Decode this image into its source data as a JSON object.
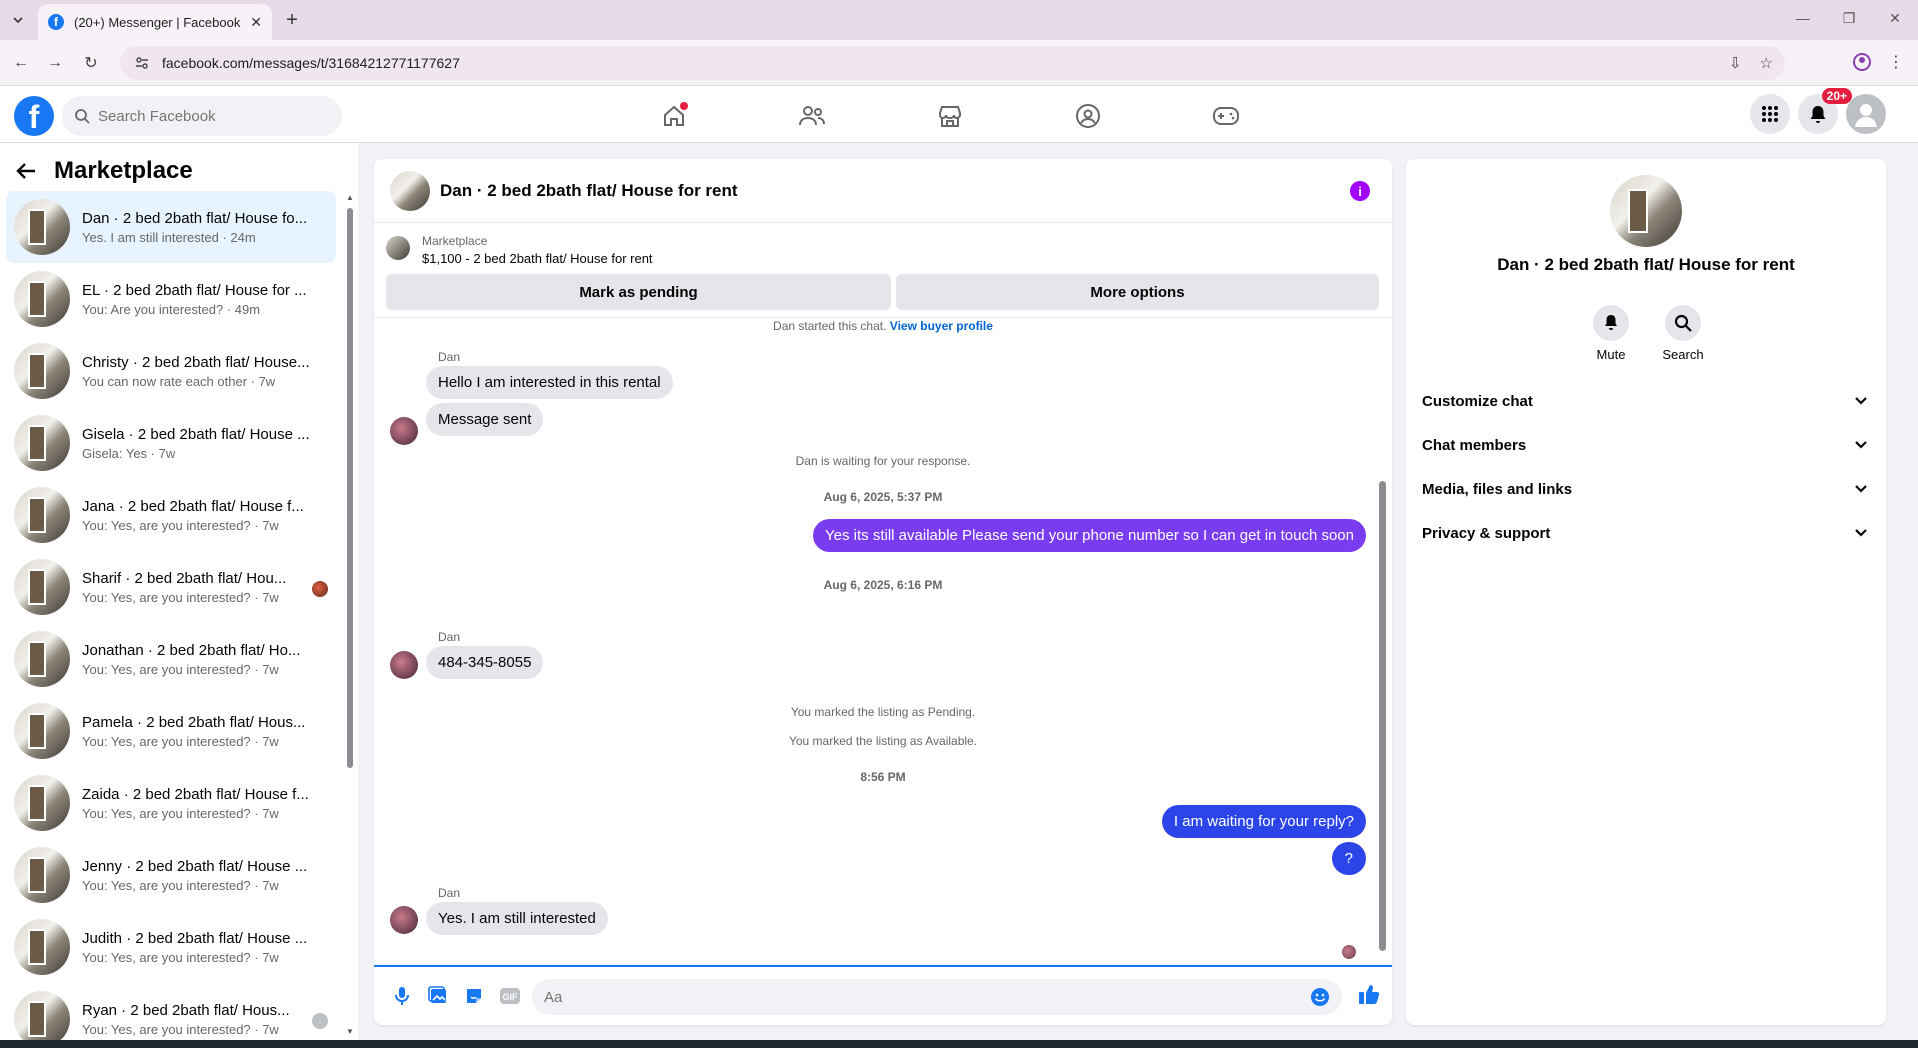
{
  "browser": {
    "tab_title": "(20+) Messenger | Facebook",
    "url": "facebook.com/messages/t/31684212771177627"
  },
  "header": {
    "search_placeholder": "Search Facebook",
    "notifications_badge": "20+"
  },
  "sidebar": {
    "title": "Marketplace",
    "conversations": [
      {
        "name": "Dan · 2 bed 2bath flat/ House fo...",
        "preview": "Yes. I am still interested · 24m",
        "active": true
      },
      {
        "name": "EL · 2 bed 2bath flat/ House for ...",
        "preview": "You: Are you interested? · 49m"
      },
      {
        "name": "Christy · 2 bed 2bath flat/ House...",
        "preview": "You can now rate each other · 7w"
      },
      {
        "name": "Gisela · 2 bed 2bath flat/ House ...",
        "preview": "Gisela: Yes · 7w"
      },
      {
        "name": "Jana · 2 bed 2bath flat/ House f...",
        "preview": "You: Yes, are you interested? · 7w"
      },
      {
        "name": "Sharif · 2 bed 2bath flat/ Hou...",
        "preview": "You: Yes, are you interested? · 7w"
      },
      {
        "name": "Jonathan · 2 bed 2bath flat/ Ho...",
        "preview": "You: Yes, are you interested? · 7w"
      },
      {
        "name": "Pamela · 2 bed 2bath flat/ Hous...",
        "preview": "You: Yes, are you interested? · 7w"
      },
      {
        "name": "Zaida · 2 bed 2bath flat/ House f...",
        "preview": "You: Yes, are you interested? · 7w"
      },
      {
        "name": "Jenny · 2 bed 2bath flat/ House ...",
        "preview": "You: Yes, are you interested? · 7w"
      },
      {
        "name": "Judith · 2 bed 2bath flat/ House ...",
        "preview": "You: Yes, are you interested? · 7w"
      },
      {
        "name": "Ryan · 2 bed 2bath flat/ Hous...",
        "preview": "You: Yes, are you interested? · 7w"
      }
    ]
  },
  "chat": {
    "title": "Dan · 2 bed 2bath flat/ House for rent",
    "marketplace_label": "Marketplace",
    "listing": "$1,100 - 2 bed 2bath flat/ House for rent",
    "mark_pending_label": "Mark as pending",
    "more_options_label": "More options",
    "started_text": "Dan started this chat.",
    "view_profile_label": "View buyer profile",
    "sender_name": "Dan",
    "msg_in_1": "Hello I am interested in this rental",
    "msg_in_2": "Message sent",
    "waiting_text": "Dan is waiting for your response.",
    "ts_1": "Aug 6, 2025, 5:37 PM",
    "msg_out_1": "Yes its still available Please send your phone number so I can get in touch soon",
    "ts_2": "Aug 6, 2025, 6:16 PM",
    "msg_in_3": "484-345-8055",
    "sys_pending": "You marked the listing as Pending.",
    "sys_available": "You marked the listing as Available.",
    "ts_3": "8:56 PM",
    "msg_out_2": "I am waiting for your reply?",
    "msg_out_3": "?",
    "msg_in_4": "Yes. I am still interested",
    "composer_placeholder": "Aa"
  },
  "right_panel": {
    "name": "Dan · 2 bed 2bath flat/ House for rent",
    "mute_label": "Mute",
    "search_label": "Search",
    "sections": [
      "Customize chat",
      "Chat members",
      "Media, files and links",
      "Privacy & support"
    ]
  },
  "colors": {
    "out_purple": "#7a3cf0",
    "out_blue": "#2b45e8",
    "fb_blue": "#1877f2"
  }
}
